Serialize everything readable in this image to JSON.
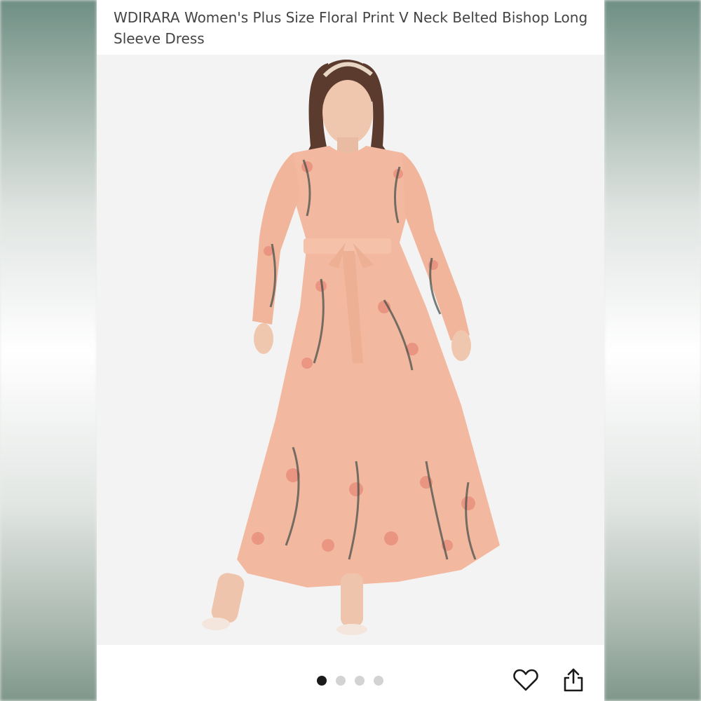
{
  "product": {
    "title": "WDIRARA Women's Plus Size Floral Print V Neck Belted Bishop Long Sleeve Dress"
  },
  "gallery": {
    "image_count": 4,
    "active_index": 0,
    "image_icon": "dress-photo"
  },
  "actions": {
    "favorite_icon": "heart-icon",
    "share_icon": "share-icon"
  },
  "colors": {
    "dress": "#f3b9a0",
    "active_dot": "#1a1a1a",
    "inactive_dot": "#d3d3d3"
  }
}
